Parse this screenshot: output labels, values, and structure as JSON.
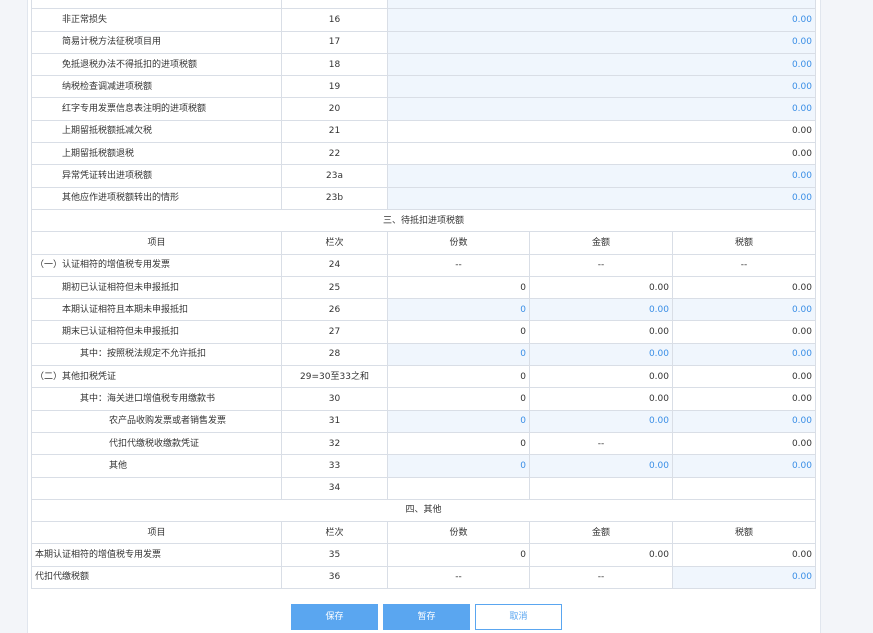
{
  "rows_top": [
    {
      "label": "",
      "col": "",
      "val": "0.00",
      "editable": true,
      "indent": 1
    },
    {
      "label": "非正常损失",
      "col": "16",
      "val": "0.00",
      "editable": true,
      "indent": 1
    },
    {
      "label": "简易计税方法征税项目用",
      "col": "17",
      "val": "0.00",
      "editable": true,
      "indent": 1
    },
    {
      "label": "免抵退税办法不得抵扣的进项税额",
      "col": "18",
      "val": "0.00",
      "editable": true,
      "indent": 1
    },
    {
      "label": "纳税检查调减进项税额",
      "col": "19",
      "val": "0.00",
      "editable": true,
      "indent": 1
    },
    {
      "label": "红字专用发票信息表注明的进项税额",
      "col": "20",
      "val": "0.00",
      "editable": true,
      "indent": 1
    },
    {
      "label": "上期留抵税额抵减欠税",
      "col": "21",
      "val": "0.00",
      "editable": false,
      "indent": 1
    },
    {
      "label": "上期留抵税额退税",
      "col": "22",
      "val": "0.00",
      "editable": false,
      "indent": 1
    },
    {
      "label": "异常凭证转出进项税额",
      "col": "23a",
      "val": "0.00",
      "editable": true,
      "indent": 1
    },
    {
      "label": "其他应作进项税额转出的情形",
      "col": "23b",
      "val": "0.00",
      "editable": true,
      "indent": 1
    }
  ],
  "section3": {
    "title": "三、待抵扣进项税额",
    "headers": [
      "项目",
      "栏次",
      "份数",
      "金额",
      "税额"
    ],
    "rows": [
      {
        "label": "（一）认证相符的增值税专用发票",
        "col": "24",
        "cells": [
          {
            "v": "--",
            "e": false,
            "a": "c"
          },
          {
            "v": "--",
            "e": false,
            "a": "c"
          },
          {
            "v": "--",
            "e": false,
            "a": "c"
          }
        ],
        "indent": 0
      },
      {
        "label": "期初已认证相符但未申报抵扣",
        "col": "25",
        "cells": [
          {
            "v": "0",
            "e": false,
            "a": "r"
          },
          {
            "v": "0.00",
            "e": false,
            "a": "r"
          },
          {
            "v": "0.00",
            "e": false,
            "a": "r"
          }
        ],
        "indent": 1
      },
      {
        "label": "本期认证相符且本期未申报抵扣",
        "col": "26",
        "cells": [
          {
            "v": "0",
            "e": true,
            "a": "r"
          },
          {
            "v": "0.00",
            "e": true,
            "a": "r"
          },
          {
            "v": "0.00",
            "e": true,
            "a": "r"
          }
        ],
        "indent": 1
      },
      {
        "label": "期末已认证相符但未申报抵扣",
        "col": "27",
        "cells": [
          {
            "v": "0",
            "e": false,
            "a": "r"
          },
          {
            "v": "0.00",
            "e": false,
            "a": "r"
          },
          {
            "v": "0.00",
            "e": false,
            "a": "r"
          }
        ],
        "indent": 1
      },
      {
        "label": "其中：按照税法规定不允许抵扣",
        "col": "28",
        "cells": [
          {
            "v": "0",
            "e": true,
            "a": "r"
          },
          {
            "v": "0.00",
            "e": true,
            "a": "r"
          },
          {
            "v": "0.00",
            "e": true,
            "a": "r"
          }
        ],
        "indent": 2
      },
      {
        "label": "（二）其他扣税凭证",
        "col": "29=30至33之和",
        "cells": [
          {
            "v": "0",
            "e": false,
            "a": "r"
          },
          {
            "v": "0.00",
            "e": false,
            "a": "r"
          },
          {
            "v": "0.00",
            "e": false,
            "a": "r"
          }
        ],
        "indent": 0
      },
      {
        "label": "其中：海关进口增值税专用缴款书",
        "col": "30",
        "cells": [
          {
            "v": "0",
            "e": false,
            "a": "r"
          },
          {
            "v": "0.00",
            "e": false,
            "a": "r"
          },
          {
            "v": "0.00",
            "e": false,
            "a": "r"
          }
        ],
        "indent": 2
      },
      {
        "label": "农产品收购发票或者销售发票",
        "col": "31",
        "cells": [
          {
            "v": "0",
            "e": true,
            "a": "r"
          },
          {
            "v": "0.00",
            "e": true,
            "a": "r"
          },
          {
            "v": "0.00",
            "e": true,
            "a": "r"
          }
        ],
        "indent": 3
      },
      {
        "label": "代扣代缴税收缴款凭证",
        "col": "32",
        "cells": [
          {
            "v": "0",
            "e": false,
            "a": "r"
          },
          {
            "v": "--",
            "e": false,
            "a": "c"
          },
          {
            "v": "0.00",
            "e": false,
            "a": "r"
          }
        ],
        "indent": 3
      },
      {
        "label": "其他",
        "col": "33",
        "cells": [
          {
            "v": "0",
            "e": true,
            "a": "r"
          },
          {
            "v": "0.00",
            "e": true,
            "a": "r"
          },
          {
            "v": "0.00",
            "e": true,
            "a": "r"
          }
        ],
        "indent": 3
      },
      {
        "label": "",
        "col": "34",
        "cells": [
          {
            "v": "",
            "e": false,
            "a": "r"
          },
          {
            "v": "",
            "e": false,
            "a": "r"
          },
          {
            "v": "",
            "e": false,
            "a": "r"
          }
        ],
        "indent": 0
      }
    ]
  },
  "section4": {
    "title": "四、其他",
    "headers": [
      "项目",
      "栏次",
      "份数",
      "金额",
      "税额"
    ],
    "rows": [
      {
        "label": "本期认证相符的增值税专用发票",
        "col": "35",
        "cells": [
          {
            "v": "0",
            "e": false,
            "a": "r"
          },
          {
            "v": "0.00",
            "e": false,
            "a": "r"
          },
          {
            "v": "0.00",
            "e": false,
            "a": "r"
          }
        ],
        "indent": 0
      },
      {
        "label": "代扣代缴税额",
        "col": "36",
        "cells": [
          {
            "v": "--",
            "e": false,
            "a": "c"
          },
          {
            "v": "--",
            "e": false,
            "a": "c"
          },
          {
            "v": "0.00",
            "e": true,
            "a": "r"
          }
        ],
        "indent": 0
      }
    ]
  },
  "buttons": {
    "save": "保存",
    "temp_save": "暂存",
    "cancel": "取消"
  },
  "colors": {
    "accent": "#5aa6f0",
    "editable_bg": "#f0f6fd",
    "editable_text": "#3a8ee6"
  }
}
